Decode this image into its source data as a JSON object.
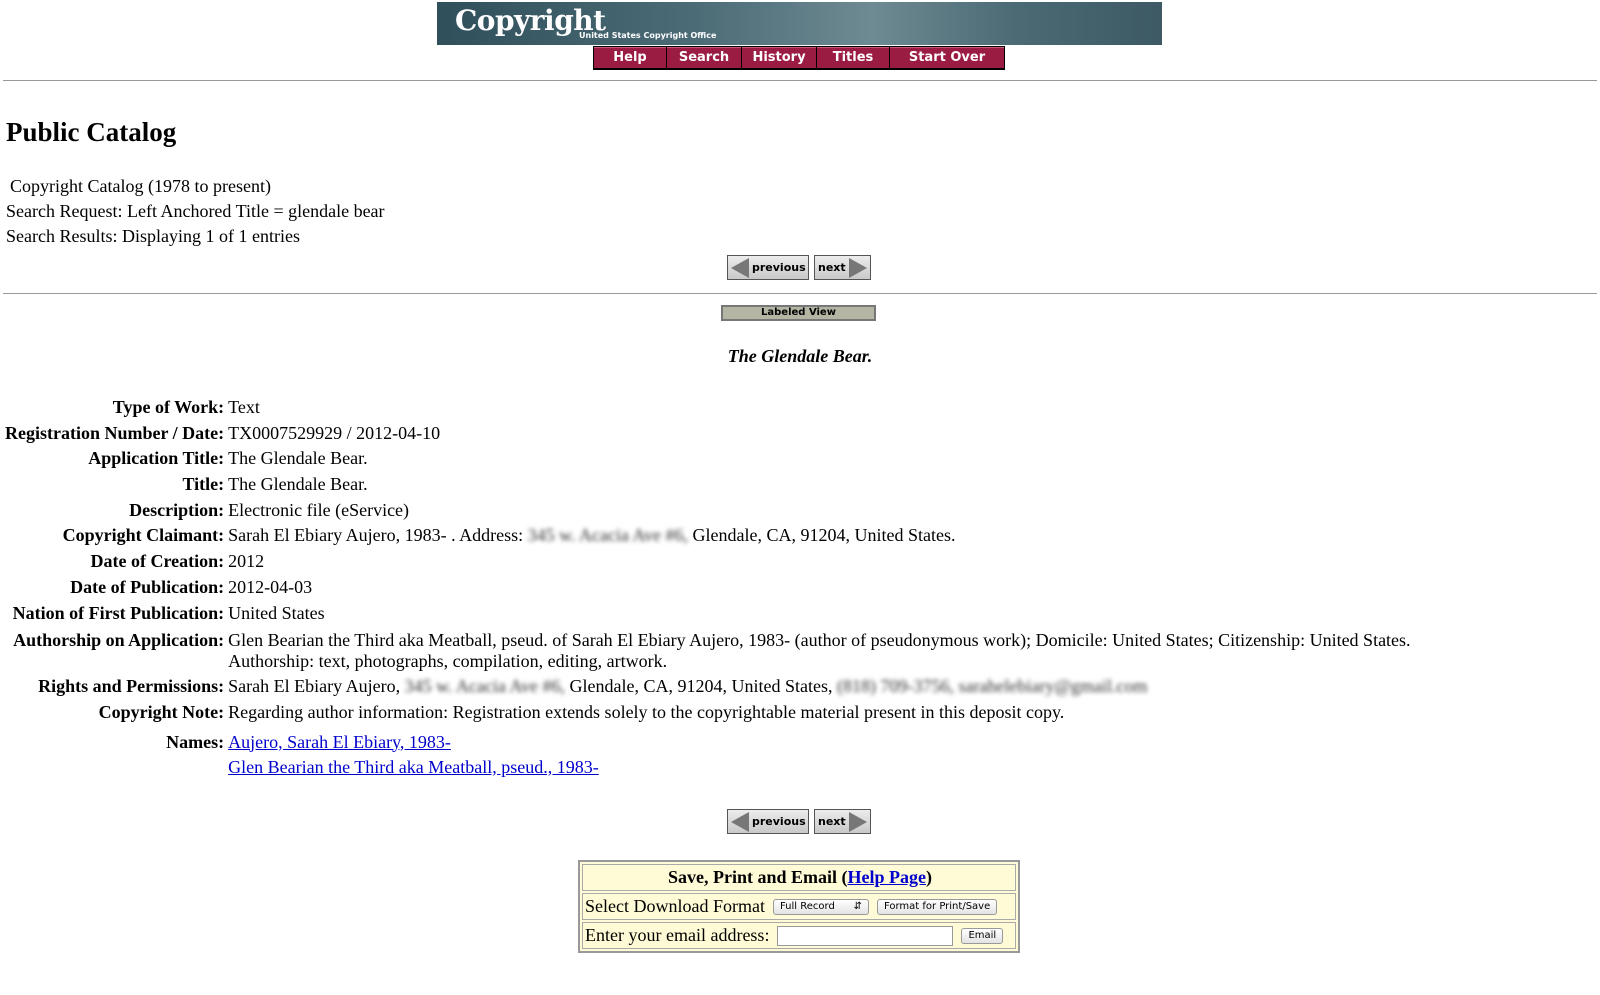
{
  "banner": {
    "logo": "Copyright",
    "subtitle": "United States Copyright Office"
  },
  "nav": [
    "Help",
    "Search",
    "History",
    "Titles",
    "Start Over"
  ],
  "page_title": "Public Catalog",
  "info": {
    "catalog": "Copyright Catalog (1978 to present)",
    "request": "Search Request: Left Anchored Title = glendale bear",
    "results": "Search Results: Displaying 1 of 1 entries"
  },
  "pager": {
    "previous": "previous",
    "next": "next"
  },
  "view_button": "Labeled View",
  "record_title": "The Glendale Bear.",
  "record": {
    "type_of_work": {
      "label": "Type of Work:",
      "value": "Text"
    },
    "registration": {
      "label": "Registration Number / Date:",
      "value": "TX0007529929 / 2012-04-10"
    },
    "application_title": {
      "label": "Application Title:",
      "value": "The Glendale Bear."
    },
    "title": {
      "label": "Title:",
      "value": "The Glendale Bear."
    },
    "description": {
      "label": "Description:",
      "value": "Electronic file (eService)"
    },
    "claimant": {
      "label": "Copyright Claimant:",
      "value_a": "Sarah El Ebiary Aujero, 1983- . Address:",
      "redacted": "345 w. Acacia Ave #6,",
      "value_b": "Glendale, CA, 91204, United States."
    },
    "date_of_creation": {
      "label": "Date of Creation:",
      "value": "2012"
    },
    "date_of_publication": {
      "label": "Date of Publication:",
      "value": "2012-04-03"
    },
    "nation": {
      "label": "Nation of First Publication:",
      "value": "United States"
    },
    "authorship": {
      "label": "Authorship on Application:",
      "value": "Glen Bearian the Third aka Meatball, pseud. of Sarah El Ebiary Aujero, 1983- (author of pseudonymous work); Domicile: United States; Citizenship: United States.",
      "value2": "Authorship: text, photographs, compilation, editing, artwork."
    },
    "rights": {
      "label": "Rights and Permissions:",
      "value_a": "Sarah El Ebiary Aujero,",
      "redacted_a": "345 w. Acacia Ave #6,",
      "value_b": "Glendale, CA, 91204, United States,",
      "redacted_b": "(818) 709-3756, sarahelebiary@gmail.com"
    },
    "note": {
      "label": "Copyright Note:",
      "value": "Regarding author information: Registration extends solely to the copyrightable material present in this deposit copy."
    },
    "names": {
      "label": "Names:",
      "links": [
        "Aujero, Sarah El Ebiary, 1983-",
        "Glen Bearian the Third aka Meatball, pseud., 1983-"
      ]
    }
  },
  "save": {
    "heading": "Save, Print and Email",
    "help_link": "Help Page",
    "download_label": "Select Download Format",
    "format_selected": "Full Record",
    "format_button": "Format for Print/Save",
    "email_label": "Enter your email address:",
    "email_value": "",
    "email_button": "Email"
  }
}
